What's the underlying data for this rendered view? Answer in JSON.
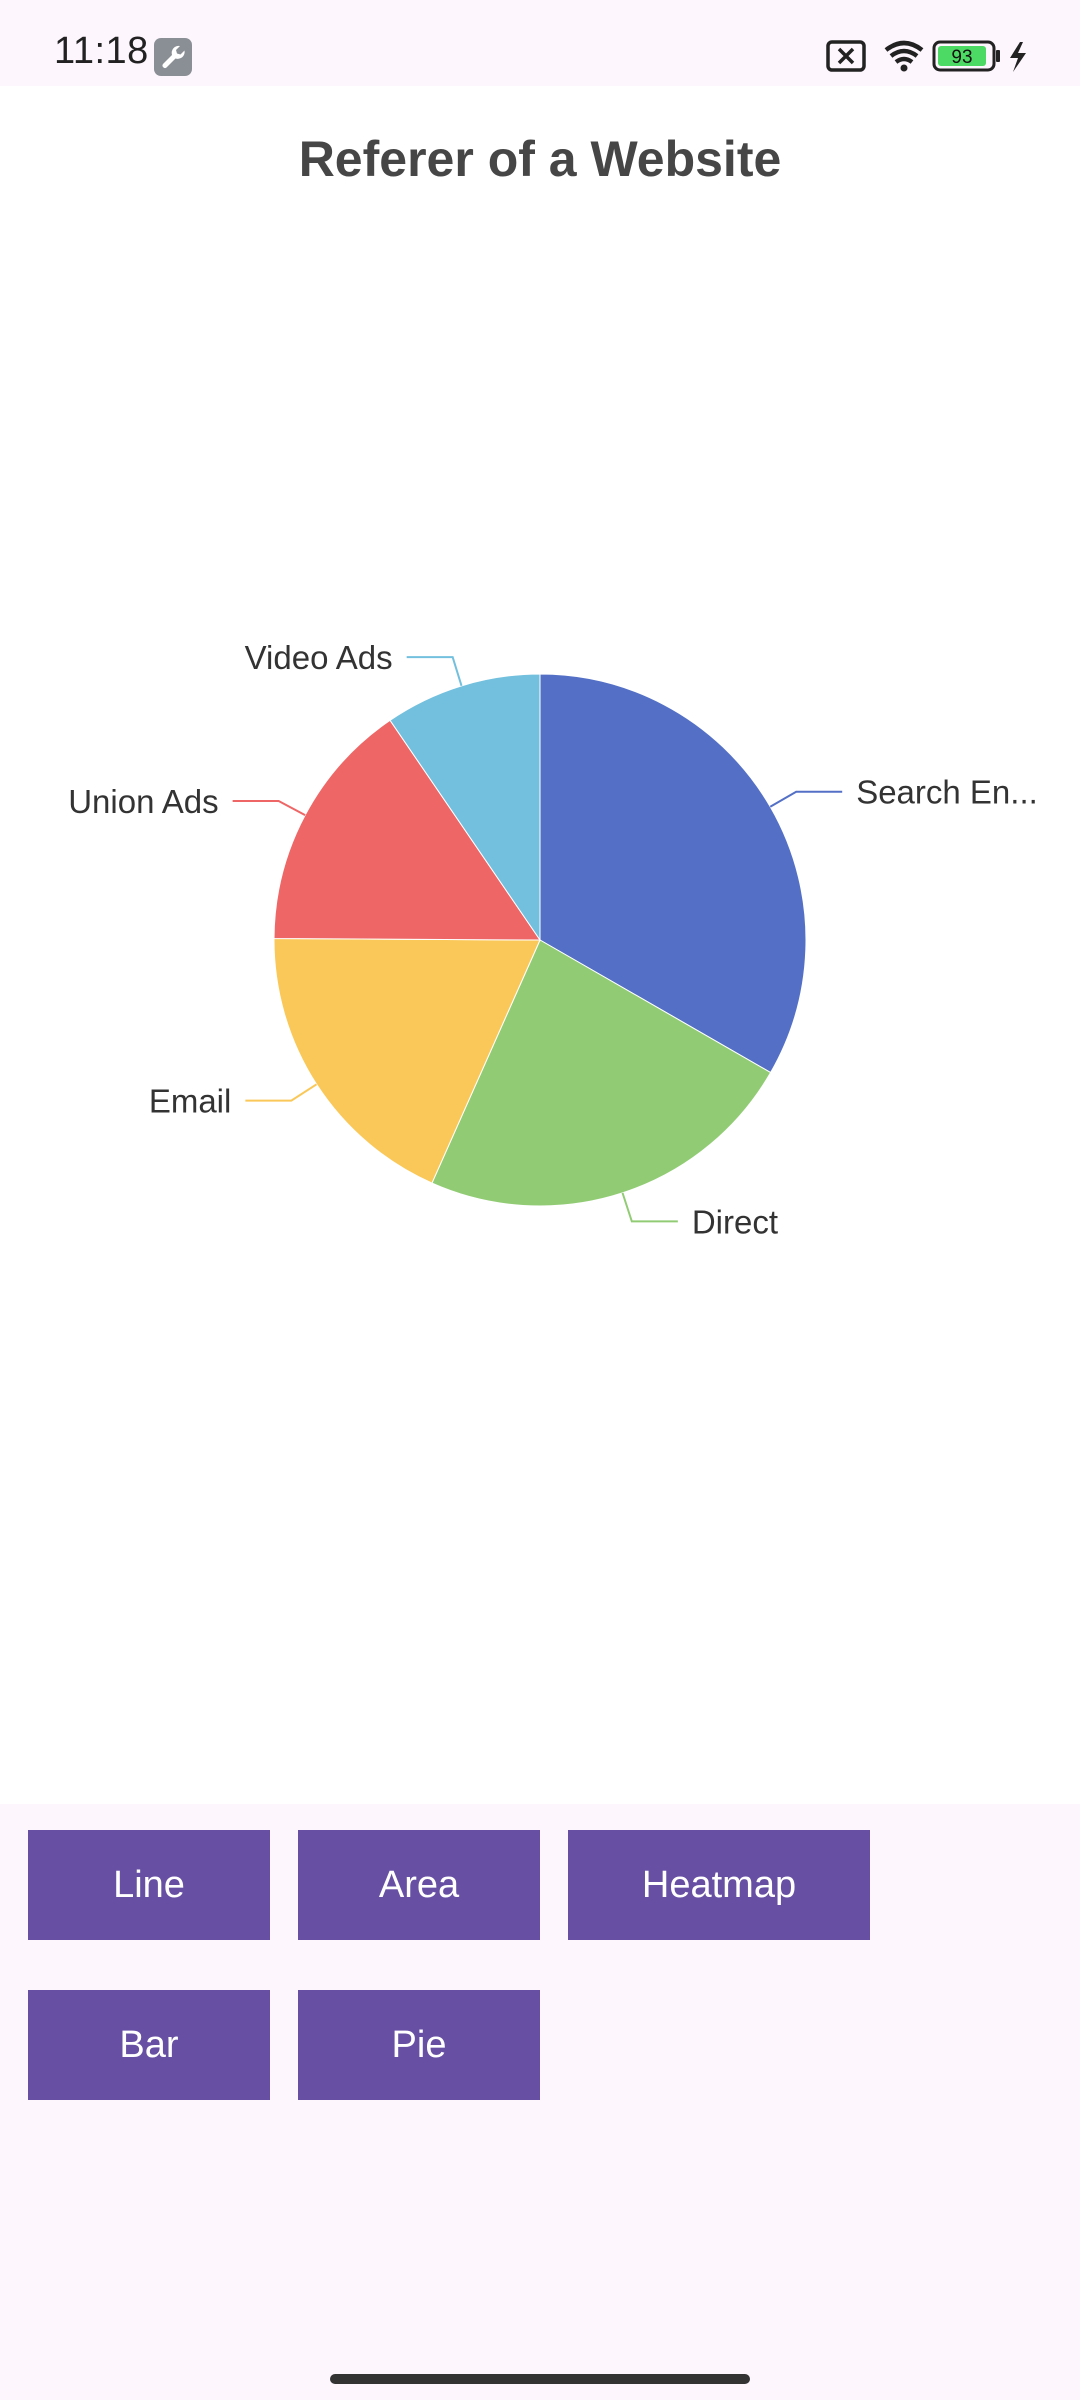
{
  "status_bar": {
    "time": "11:18",
    "battery": "93",
    "icons": [
      "wrench-icon",
      "sim-error-icon",
      "wifi-icon",
      "battery-icon",
      "charging-icon"
    ]
  },
  "chart_title": "Referer of a Website",
  "chart_data": {
    "type": "pie",
    "title": "Referer of a Website",
    "labels": [
      "Search En...",
      "Direct",
      "Email",
      "Union Ads",
      "Video Ads"
    ],
    "values": [
      1048,
      735,
      580,
      484,
      300
    ],
    "colors": [
      "#5470c6",
      "#91cc75",
      "#fac858",
      "#ee6666",
      "#73c0de"
    ]
  },
  "buttons": [
    {
      "label": "Line"
    },
    {
      "label": "Area"
    },
    {
      "label": "Heatmap"
    },
    {
      "label": "Bar"
    },
    {
      "label": "Pie"
    }
  ]
}
